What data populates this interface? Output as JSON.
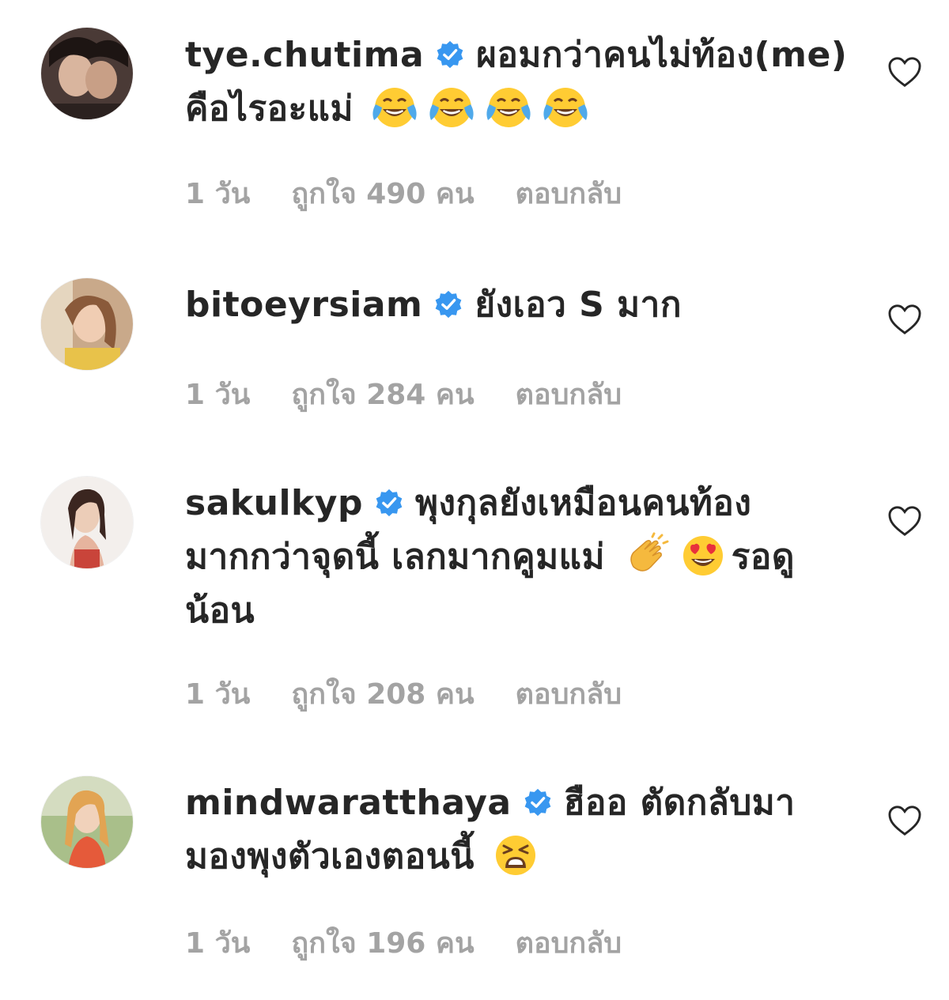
{
  "comments": [
    {
      "username": "tye.chutima",
      "text": "ผอมกว่าคนไม่ท้อง(me) คือไรอะแม่",
      "emoji": [
        "face-with-tears-of-joy",
        "face-with-tears-of-joy",
        "face-with-tears-of-joy",
        "face-with-tears-of-joy"
      ],
      "time": "1 วัน",
      "likes": "ถูกใจ 490 คน",
      "reply": "ตอบกลับ"
    },
    {
      "username": "bitoeyrsiam",
      "text": "ยังเอว S มาก",
      "time": "1 วัน",
      "likes": "ถูกใจ 284 คน",
      "reply": "ตอบกลับ"
    },
    {
      "username": "sakulkyp",
      "text_before": "พุงกุลยังเหมือนคนท้องมากกว่าจุดนี้ เลกมากคูมแม่",
      "text_after": "รอดูน้อน",
      "emoji": [
        "clapping-hands",
        "smiling-face-with-heart-eyes"
      ],
      "time": "1 วัน",
      "likes": "ถูกใจ 208 คน",
      "reply": "ตอบกลับ"
    },
    {
      "username": "mindwaratthaya",
      "text": "ฮืออ ตัดกลับมามองพุงตัวเองตอนนี้",
      "emoji": [
        "tired-face"
      ],
      "time": "1 วัน",
      "likes": "ถูกใจ 196 คน",
      "reply": "ตอบกลับ"
    }
  ],
  "colors": {
    "text": "#262626",
    "meta": "#a3a3a3",
    "verified": "#3897f0",
    "heart_outline": "#262626"
  },
  "icons": {
    "verified": "verified-badge-icon",
    "like": "heart-outline-icon"
  }
}
